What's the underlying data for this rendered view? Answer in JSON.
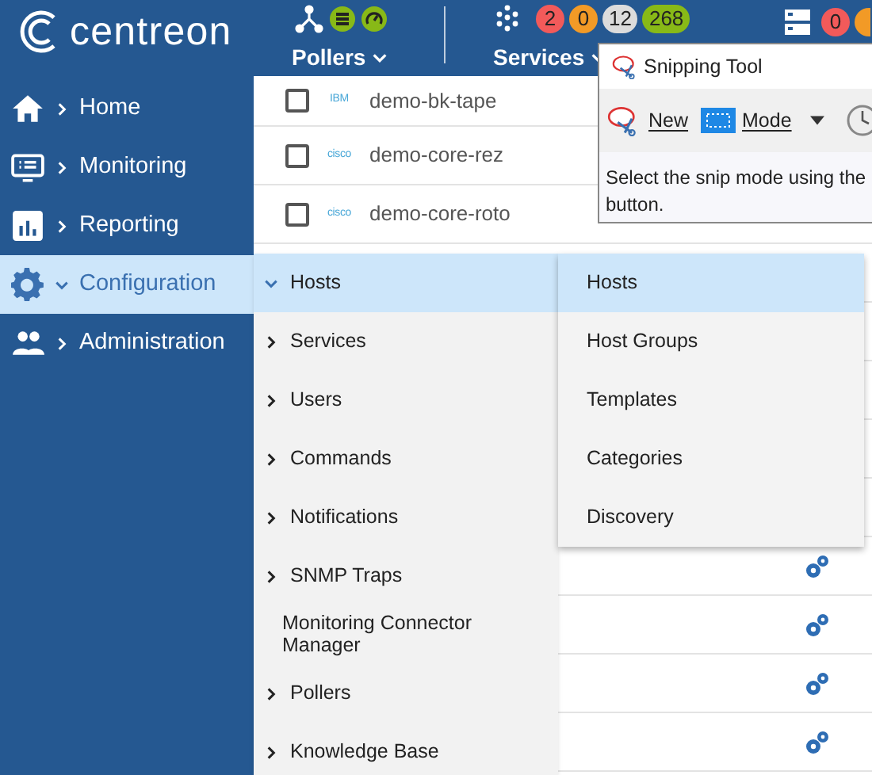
{
  "header": {
    "logo": "centreon",
    "pollers": {
      "label": "Pollers"
    },
    "services": {
      "label": "Services",
      "badges": [
        {
          "text": "2",
          "color": "#f25a5a"
        },
        {
          "text": "0",
          "color": "#f29a26"
        },
        {
          "text": "12",
          "color": "#dcdcdc"
        },
        {
          "text": "268",
          "color": "#88b917"
        }
      ]
    },
    "hosts": {
      "badges": [
        {
          "text": "0",
          "color": "#f25a5a"
        }
      ]
    }
  },
  "sidebar": {
    "items": [
      {
        "label": "Home",
        "selected": false,
        "expanded": false
      },
      {
        "label": "Monitoring",
        "selected": false,
        "expanded": false
      },
      {
        "label": "Reporting",
        "selected": false,
        "expanded": false
      },
      {
        "label": "Configuration",
        "selected": true,
        "expanded": true
      },
      {
        "label": "Administration",
        "selected": false,
        "expanded": false
      }
    ]
  },
  "table": {
    "rows": [
      {
        "kind": "host",
        "checked": false,
        "vendor": "IBM",
        "name": "demo-bk-tape"
      },
      {
        "kind": "host",
        "checked": false,
        "vendor": "cisco",
        "name": "demo-core-rez"
      },
      {
        "kind": "host",
        "checked": false,
        "vendor": "cisco",
        "name": "demo-core-roto"
      },
      {
        "kind": "action"
      },
      {
        "kind": "action"
      },
      {
        "kind": "action"
      },
      {
        "kind": "action"
      }
    ]
  },
  "menu": {
    "items": [
      {
        "label": "Hosts",
        "selected": true,
        "expanded": true,
        "has_children": true
      },
      {
        "label": "Services",
        "selected": false,
        "expanded": false,
        "has_children": true
      },
      {
        "label": "Users",
        "selected": false,
        "expanded": false,
        "has_children": true
      },
      {
        "label": "Commands",
        "selected": false,
        "expanded": false,
        "has_children": true
      },
      {
        "label": "Notifications",
        "selected": false,
        "expanded": false,
        "has_children": true
      },
      {
        "label": "SNMP Traps",
        "selected": false,
        "expanded": false,
        "has_children": true
      },
      {
        "label": "Monitoring Connector Manager",
        "selected": false,
        "has_children": false
      },
      {
        "label": "Pollers",
        "selected": false,
        "expanded": false,
        "has_children": true
      },
      {
        "label": "Knowledge Base",
        "selected": false,
        "expanded": false,
        "has_children": true
      }
    ]
  },
  "submenu": {
    "items": [
      {
        "label": "Hosts",
        "selected": true
      },
      {
        "label": "Host Groups",
        "selected": false
      },
      {
        "label": "Templates",
        "selected": false
      },
      {
        "label": "Categories",
        "selected": false
      },
      {
        "label": "Discovery",
        "selected": false
      }
    ]
  },
  "snipping_tool": {
    "title": "Snipping Tool",
    "buttons": [
      {
        "label": "New",
        "kind": "new"
      },
      {
        "label": "Mode",
        "kind": "mode"
      }
    ],
    "message": "Select the snip mode using the\nbutton."
  }
}
